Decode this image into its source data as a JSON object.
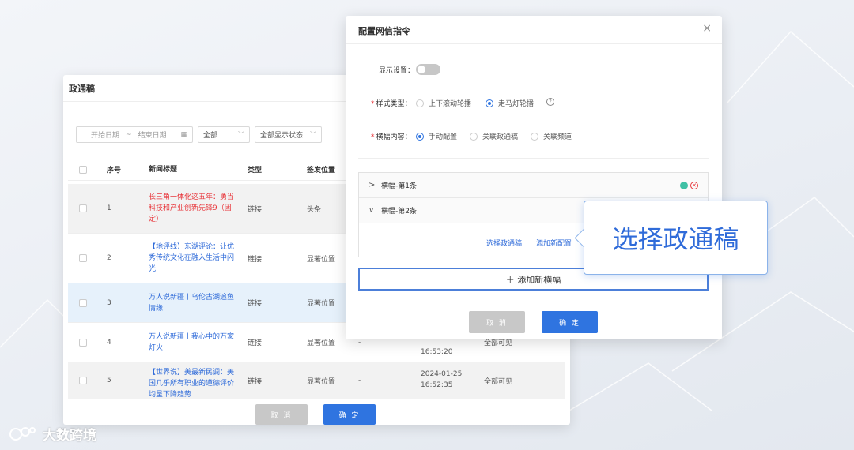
{
  "back_window": {
    "title": "政通稿",
    "filters": {
      "start_placeholder": "开始日期",
      "separator": "~",
      "end_placeholder": "结束日期",
      "category": "全部",
      "display_status": "全部显示状态"
    },
    "columns": [
      "序号",
      "新闻标题",
      "类型",
      "签发位置"
    ],
    "rows": [
      {
        "no": "1",
        "title": "长三角一体化这五年：勇当科技和产业创新先锋9（固定）",
        "type": "链接",
        "position": "头条",
        "dash": "",
        "time": "",
        "visibility": ""
      },
      {
        "no": "2",
        "title": "【地评线】东湖评论：让优秀传统文化在融入生活中闪光",
        "type": "链接",
        "position": "显著位置",
        "dash": "",
        "time": "",
        "visibility": ""
      },
      {
        "no": "3",
        "title": "万人说新疆丨乌伦古湖追鱼情缘",
        "type": "链接",
        "position": "显著位置",
        "dash": "",
        "time": "",
        "visibility": ""
      },
      {
        "no": "4",
        "title": "万人说新疆丨我心中的万家灯火",
        "type": "链接",
        "position": "显著位置",
        "dash": "-",
        "time": "16:53:20",
        "visibility": "全部可见"
      },
      {
        "no": "5",
        "title": "【世界说】美最新民调：美国几乎所有职业的道德评价均呈下降趋势",
        "type": "链接",
        "position": "显著位置",
        "dash": "-",
        "time_date": "2024-01-25",
        "time": "16:52:35",
        "visibility": "全部可见"
      }
    ],
    "cancel_label": "取 消",
    "confirm_label": "确 定"
  },
  "dialog": {
    "title": "配置网信指令",
    "close_glyph": "×",
    "display_setting_label": "显示设置：",
    "display_setting_on": false,
    "style_type_label": "样式类型：",
    "style_options": [
      "上下滚动轮播",
      "走马灯轮播"
    ],
    "style_selected": "走马灯轮播",
    "help_glyph": "?",
    "banner_content_label": "横幅内容：",
    "content_options": [
      "手动配置",
      "关联政通稿",
      "关联频道"
    ],
    "content_selected": "手动配置",
    "banners": [
      {
        "label": "横幅-第1条",
        "expanded": false
      },
      {
        "label": "横幅-第2条",
        "expanded": true
      }
    ],
    "choose_link": "选择政通稿",
    "add_config_link": "添加新配置",
    "add_banner_label": "＋ 添加新横幅",
    "cancel_label": "取 消",
    "confirm_label": "确 定"
  },
  "callout": {
    "text": "选择政通稿"
  },
  "watermark": {
    "text": "大数跨境"
  },
  "colors": {
    "accent": "#2f74e0",
    "danger": "#e8383d",
    "success": "#3fc1a5"
  }
}
